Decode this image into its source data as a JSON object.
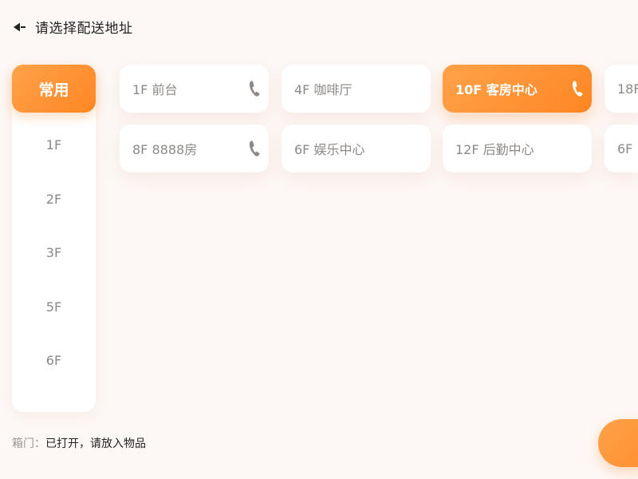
{
  "header": {
    "title": "请选择配送地址",
    "back_icon": "back-arrow-icon"
  },
  "sidebar": {
    "items": [
      {
        "label": "常用",
        "active": true
      },
      {
        "label": "1F"
      },
      {
        "label": "2F"
      },
      {
        "label": "3F"
      },
      {
        "label": "5F"
      },
      {
        "label": "6F"
      }
    ]
  },
  "locations": [
    {
      "label": "1F 前台",
      "phone": true
    },
    {
      "label": "4F 咖啡厅",
      "phone": false
    },
    {
      "label": "10F 客房中心",
      "phone": true,
      "selected": true
    },
    {
      "label": "18F",
      "phone": false
    },
    {
      "label": "8F 8888房",
      "phone": true
    },
    {
      "label": "6F 娱乐中心",
      "phone": false
    },
    {
      "label": "12F 后勤中心",
      "phone": false
    },
    {
      "label": "6F",
      "phone": false
    }
  ],
  "status": {
    "label": "箱门：",
    "value": "已打开，请放入物品"
  },
  "colors": {
    "accent": "#ff8623",
    "accent_light": "#ffa24a",
    "background": "#fdf8f6",
    "card": "#ffffff",
    "text_muted": "#8e8986",
    "text_dark": "#222222"
  }
}
